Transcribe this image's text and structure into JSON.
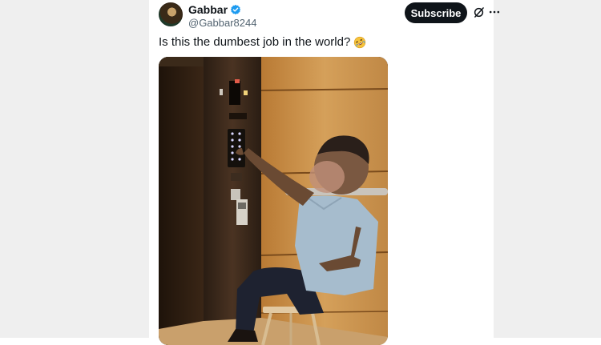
{
  "author": {
    "display_name": "Gabbar",
    "handle": "@Gabbar8244",
    "verified": true
  },
  "actions": {
    "subscribe_label": "Subscribe",
    "grok_icon": "grok-icon",
    "more_icon": "more-icon"
  },
  "tweet": {
    "text": "Is this the dumbest job in the world?",
    "emoji_icon": "rofl-emoji-icon"
  },
  "media": {
    "alt": "Man sitting on a stool pressing elevator buttons"
  },
  "colors": {
    "accent": "#1d9bf0",
    "subscribe_bg": "#0f1419",
    "handle": "#536471",
    "side_bg": "#efefef"
  }
}
